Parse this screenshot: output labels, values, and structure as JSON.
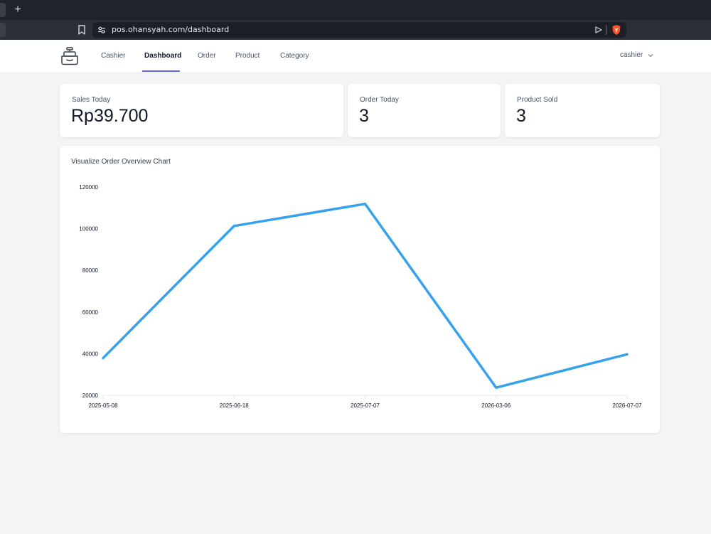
{
  "browser": {
    "new_tab_symbol": "+",
    "url": "pos.ohansyah.com/dashboard"
  },
  "nav": {
    "items": [
      {
        "label": "Cashier",
        "active": false
      },
      {
        "label": "Dashboard",
        "active": true
      },
      {
        "label": "Order",
        "active": false
      },
      {
        "label": "Product",
        "active": false
      },
      {
        "label": "Category",
        "active": false
      }
    ],
    "user": "cashier",
    "accent_color": "#6366f1"
  },
  "stats": {
    "sales_today": {
      "label": "Sales Today",
      "value": "Rp39.700"
    },
    "order_today": {
      "label": "Order Today",
      "value": "3"
    },
    "product_sold": {
      "label": "Product Sold",
      "value": "3"
    }
  },
  "chart_data": {
    "type": "line",
    "title": "Visualize Order Overview Chart",
    "xlabel": "",
    "ylabel": "",
    "categories": [
      "2025-05-08",
      "2025-06-18",
      "2025-07-07",
      "2026-03-06",
      "2026-07-07"
    ],
    "series": [
      {
        "values": [
          37900,
          101300,
          111900,
          23700,
          39700
        ],
        "color": "#36a2eb"
      }
    ],
    "y_ticks": [
      "20000",
      "40000",
      "60000",
      "80000",
      "100000",
      "120000"
    ],
    "ylim": [
      20000,
      120000
    ],
    "grid": false,
    "legend": "none"
  }
}
